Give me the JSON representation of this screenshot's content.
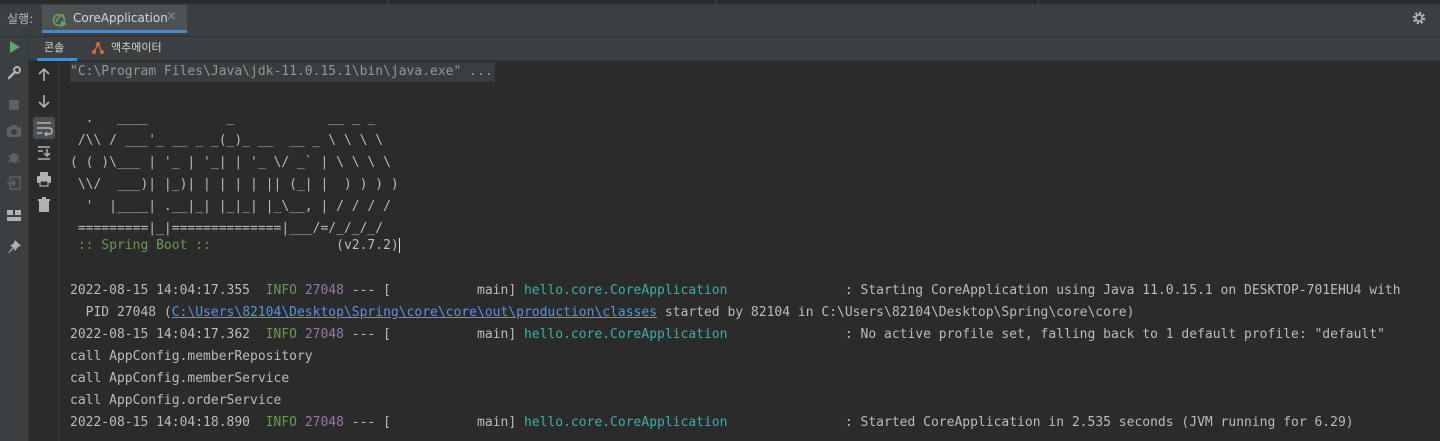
{
  "runbar": {
    "label": "실행:",
    "tab_label": "CoreApplication",
    "close_glyph": "×"
  },
  "subtabs": {
    "console": "콘솔",
    "actuator": "액추에이터"
  },
  "console": {
    "cmd": "\"C:\\Program Files\\Java\\jdk-11.0.15.1\\bin\\java.exe\" ...",
    "banner": [
      "  .   ____          _            __ _ _",
      " /\\\\ / ___'_ __ _ _(_)_ __  __ _ \\ \\ \\ \\",
      "( ( )\\___ | '_ | '_| | '_ \\/ _` | \\ \\ \\ \\",
      " \\\\/  ___)| |_)| | | | | || (_| |  ) ) ) )",
      "  '  |____| .__|_| |_|_| |_\\__, | / / / /",
      " =========|_|==============|___/=/_/_/_/"
    ],
    "spring_boot": " :: Spring Boot :: ",
    "version": "               (v2.7.2)",
    "log1": {
      "ts": "2022-08-15 14:04:17.355",
      "level": "INFO",
      "pid": "27048",
      "thread": " --- [           main] ",
      "logger": "hello.core.CoreApplication",
      "msg": "               : Starting CoreApplication using Java 11.0.15.1 on DESKTOP-701EHU4 with",
      "cont_prefix": "  PID 27048 (",
      "cont_link": "C:\\Users\\82104\\Desktop\\Spring\\core\\core\\out\\production\\classes",
      "cont_suffix": " started by 82104 in C:\\Users\\82104\\Desktop\\Spring\\core\\core)"
    },
    "log2": {
      "ts": "2022-08-15 14:04:17.362",
      "level": "INFO",
      "pid": "27048",
      "thread": " --- [           main] ",
      "logger": "hello.core.CoreApplication",
      "msg": "               : No active profile set, falling back to 1 default profile: \"default\""
    },
    "calls": [
      "call AppConfig.memberRepository",
      "call AppConfig.memberService",
      "call AppConfig.orderService"
    ],
    "log3": {
      "ts": "2022-08-15 14:04:18.890",
      "level": "INFO",
      "pid": "27048",
      "thread": " --- [           main] ",
      "logger": "hello.core.CoreApplication",
      "msg": "               : Started CoreApplication in 2.535 seconds (JVM running for 6.29)"
    }
  },
  "icons": {
    "run": "run-icon",
    "wrench": "wrench-icon",
    "stop": "stop-icon",
    "camera": "camera-icon",
    "bug": "bug-icon",
    "login": "login-icon",
    "layout": "layout-icon",
    "pin": "pin-icon",
    "up": "arrow-up-icon",
    "down": "arrow-down-icon",
    "wrap": "soft-wrap-icon",
    "scroll": "scroll-to-end-icon",
    "print": "print-icon",
    "trash": "trash-icon",
    "gear": "gear-icon"
  },
  "colors": {
    "accent": "#4a88c7",
    "info": "#6a9955",
    "pid": "#9876aa",
    "logger": "#3daea8",
    "link": "#5394ec"
  }
}
